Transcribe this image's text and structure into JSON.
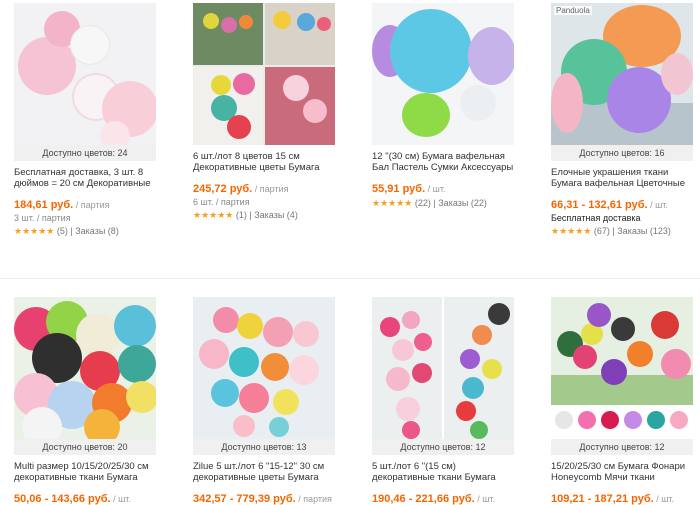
{
  "products": [
    {
      "availability": "Доступно цветов: 24",
      "title": "Бесплатная доставка, 3 шт. 8 дюймов = 20 см Декоративные",
      "price": "184,61 руб.",
      "unit": "/ партия",
      "lot": "3 шт. / партия",
      "reviews": "(5)",
      "orders": "Заказы (8)"
    },
    {
      "availability": "",
      "title": "6 шт./лот 8 цветов 15 см Декоративные цветы Бумага",
      "price": "245,72 руб.",
      "unit": "/ партия",
      "lot": "6 шт. / партия",
      "reviews": "(1)",
      "orders": "Заказы (4)"
    },
    {
      "availability": "",
      "title": "12 \"(30 см) Бумага вафельная Бал Пастель Сумки Аксессуары",
      "price": "55,91 руб.",
      "unit": "/ шт.",
      "reviews": "(22)",
      "orders": "Заказы (22)"
    },
    {
      "availability": "Доступно цветов: 16",
      "title": "Елочные украшения ткани Бумага вафельная Цветочные",
      "price": "66,31 - 132,61 руб.",
      "unit": "/ шт.",
      "free_shipping": "Бесплатная доставка",
      "reviews": "(67)",
      "orders": "Заказы (123)",
      "brand": "Panduola"
    },
    {
      "availability": "Доступно цветов: 20",
      "title": "Multi размер 10/15/20/25/30 см декоративные ткани Бумага",
      "price": "50,06 - 143,66 руб.",
      "unit": "/ шт."
    },
    {
      "availability": "Доступно цветов: 13",
      "title": "Zilue 5 шт./лот 6 \"15-12\" 30 см декоративные цветы Бумага",
      "price": "342,57 - 779,39 руб.",
      "unit": "/ партия"
    },
    {
      "availability": "Доступно цветов: 12",
      "title": "5 шт./лот 6 \"(15 см) декоративные ткани Бумага",
      "price": "190,46 - 221,66 руб.",
      "unit": "/ шт."
    },
    {
      "availability": "Доступно цветов: 12",
      "title": "15/20/25/30 см Бумага Фонари Honeycomb Мячи ткани",
      "price": "109,21 - 187,21 руб.",
      "unit": "/ шт."
    }
  ],
  "rating": {
    "stars": "★★★★★",
    "separator": "|"
  },
  "colors": {
    "price": "#f56600",
    "star": "#f3a11c",
    "availability_bg": "#f0f0f0"
  }
}
